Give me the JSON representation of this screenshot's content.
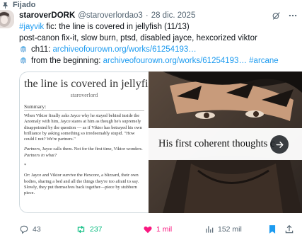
{
  "pinned": {
    "label": "Fijado"
  },
  "author": {
    "display_name": "staroverDORK",
    "handle": "@staroverlordao3",
    "separator": "·",
    "date": "28 dic. 2025"
  },
  "tweet": {
    "line1_hashtag": "#jayvik",
    "line1_text": " fic: the line is covered in jellyfish (11/13)",
    "line2_text": "post-canon fix-it, slow burn, ptsd, disabled jayce, hexcorized viktor",
    "line3_prefix": "ch11: ",
    "line3_link": "archiveofourown.org/works/61254193…",
    "line4_prefix": "from the beginning: ",
    "line4_link": "archiveofourown.org/works/61254193…",
    "line4_hashtag": " #arcane"
  },
  "card_left": {
    "title": "the line is covered in jellyfish",
    "author": "staroverlord",
    "summary_label": "Summary:",
    "p1": "When Viktor finally asks Jayce why he stayed behind inside the Anomaly with him, Jayce stares at him as though he's supremely disappointed by the question — as if Viktor has betrayed his own brilliance by asking something so irredeemably stupid. \"How could I not? We're partners.\"",
    "p2_a": "Partners",
    "p2_b": ", Jayce calls them. Not for the first time, Viktor wonders. ",
    "p2_c": "Partners in what?",
    "p3": "*",
    "p4": "Or: Jayce and Viktor survive the Hexcore, a blizzard, their own bodies, sharing a bed and all the things they're too afraid to say. Slowly, they put themselves back together—piece by stubborn piece."
  },
  "card_right": {
    "quote": "His first coherent thoughts c"
  },
  "actions": {
    "replies": "43",
    "retweets": "237",
    "likes": "1 mil",
    "views": "152 mil"
  },
  "colors": {
    "accent": "#1d9bf0",
    "retweet": "#00ba7c",
    "like": "#f91880",
    "muted": "#536471"
  }
}
